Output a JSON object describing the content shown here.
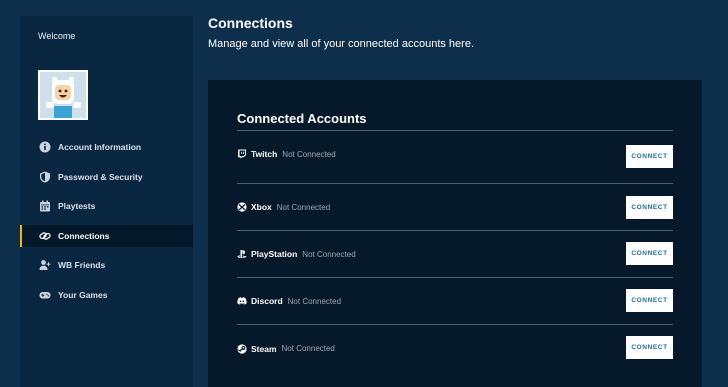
{
  "sidebar": {
    "welcome": "Welcome",
    "items": [
      {
        "label": "Account Information",
        "icon": "info-icon",
        "active": false
      },
      {
        "label": "Password & Security",
        "icon": "shield-icon",
        "active": false
      },
      {
        "label": "Playtests",
        "icon": "calendar-icon",
        "active": false
      },
      {
        "label": "Connections",
        "icon": "link-icon",
        "active": true
      },
      {
        "label": "WB Friends",
        "icon": "add-friend-icon",
        "active": false
      },
      {
        "label": "Your Games",
        "icon": "gamepad-icon",
        "active": false
      }
    ]
  },
  "header": {
    "title": "Connections",
    "subtitle": "Manage and view all of your connected accounts here."
  },
  "panel": {
    "title": "Connected Accounts",
    "accounts": [
      {
        "name": "Twitch",
        "status": "Not Connected",
        "button": "CONNECT",
        "icon": "twitch-icon"
      },
      {
        "name": "Xbox",
        "status": "Not Connected",
        "button": "CONNECT",
        "icon": "xbox-icon"
      },
      {
        "name": "PlayStation",
        "status": "Not Connected",
        "button": "CONNECT",
        "icon": "playstation-icon"
      },
      {
        "name": "Discord",
        "status": "Not Connected",
        "button": "CONNECT",
        "icon": "discord-icon"
      },
      {
        "name": "Steam",
        "status": "Not Connected",
        "button": "CONNECT",
        "icon": "steam-icon"
      }
    ]
  },
  "colors": {
    "background": "#0d2f4c",
    "sidebar": "#0a2741",
    "panel": "#06192a",
    "accent": "#f0b323",
    "button_text": "#1f6f95"
  }
}
